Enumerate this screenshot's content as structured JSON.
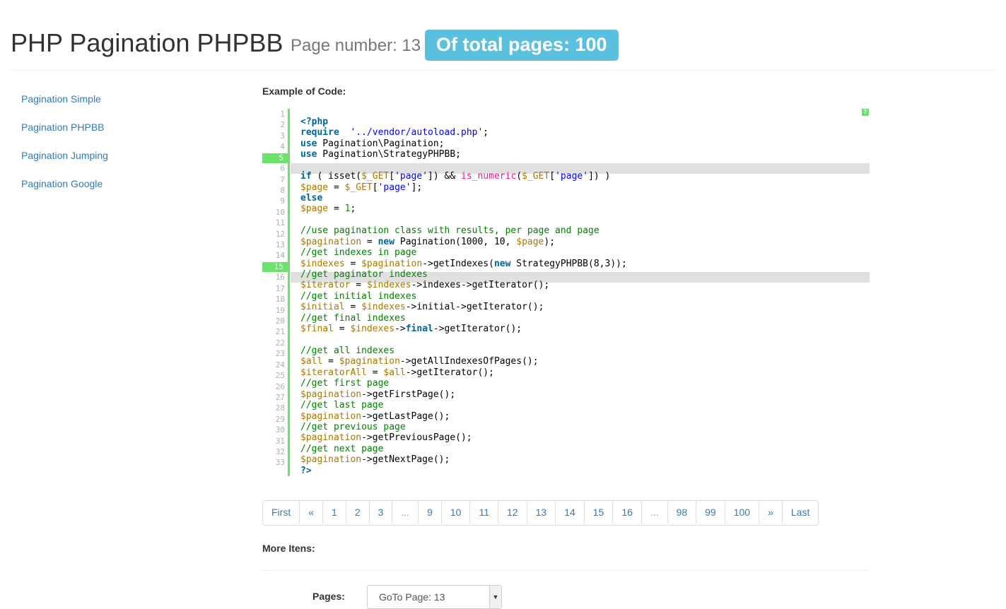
{
  "header": {
    "title": "PHP Pagination PHPBB",
    "page_number": "Page number: 13",
    "total_badge": "Of total pages: 100"
  },
  "sidebar": {
    "items": [
      {
        "label": "Pagination Simple"
      },
      {
        "label": "Pagination PHPBB"
      },
      {
        "label": "Pagination Jumping"
      },
      {
        "label": "Pagination Google"
      }
    ]
  },
  "code": {
    "heading": "Example of Code:",
    "help": "?",
    "line_numbers": [
      "1",
      "2",
      "3",
      "4",
      "5",
      "6",
      "7",
      "8",
      "9",
      "10",
      "11",
      "12",
      "13",
      "14",
      "15",
      "16",
      "17",
      "18",
      "19",
      "20",
      "21",
      "22",
      "23",
      "24",
      "25",
      "26",
      "27",
      "28",
      "29",
      "30",
      "31",
      "32",
      "33"
    ],
    "highlighted_numbers": [
      "5",
      "15"
    ],
    "lines": [
      [
        [
          "kw",
          "<?php"
        ]
      ],
      [
        [
          "kw",
          "require"
        ],
        [
          "",
          "  "
        ],
        [
          "str",
          "'../vendor/autoload.php'"
        ],
        [
          "",
          ";"
        ]
      ],
      [
        [
          "kw",
          "use"
        ],
        [
          "",
          " Pagination\\Pagination;"
        ]
      ],
      [
        [
          "kw",
          "use"
        ],
        [
          "",
          " Pagination\\StrategyPHPBB;"
        ]
      ],
      [],
      [
        [
          "kw",
          "if"
        ],
        [
          "",
          " ( isset("
        ],
        [
          "var",
          "$_GET"
        ],
        [
          "",
          "["
        ],
        [
          "str",
          "'page'"
        ],
        [
          "",
          "]) && "
        ],
        [
          "fn",
          "is_numeric"
        ],
        [
          "",
          "("
        ],
        [
          "var",
          "$_GET"
        ],
        [
          "",
          "["
        ],
        [
          "str",
          "'page'"
        ],
        [
          "",
          "]) )"
        ]
      ],
      [
        [
          "var",
          "$page"
        ],
        [
          "",
          " = "
        ],
        [
          "var",
          "$_GET"
        ],
        [
          "",
          "["
        ],
        [
          "str",
          "'page'"
        ],
        [
          "",
          "];"
        ]
      ],
      [
        [
          "kw",
          "else"
        ]
      ],
      [
        [
          "var",
          "$page"
        ],
        [
          "",
          " = "
        ],
        [
          "num",
          "1"
        ],
        [
          "",
          ";"
        ]
      ],
      [],
      [
        [
          "cm",
          "//use pagination class with results, per page and page"
        ]
      ],
      [
        [
          "var",
          "$pagination"
        ],
        [
          "",
          " = "
        ],
        [
          "kw",
          "new"
        ],
        [
          "",
          " Pagination(1000, 10, "
        ],
        [
          "var",
          "$page"
        ],
        [
          "",
          ");"
        ]
      ],
      [
        [
          "cm",
          "//get indexes in page"
        ]
      ],
      [
        [
          "var",
          "$indexes"
        ],
        [
          "",
          " = "
        ],
        [
          "var",
          "$pagination"
        ],
        [
          "",
          "->getIndexes("
        ],
        [
          "kw",
          "new"
        ],
        [
          "",
          " StrategyPHPBB(8,3));"
        ]
      ],
      [
        [
          "cm",
          "//get paginator indexes"
        ]
      ],
      [
        [
          "var",
          "$iterator"
        ],
        [
          "",
          " = "
        ],
        [
          "var",
          "$indexes"
        ],
        [
          "",
          "->indexes->getIterator();"
        ]
      ],
      [
        [
          "cm",
          "//get initial indexes"
        ]
      ],
      [
        [
          "var",
          "$initial"
        ],
        [
          "",
          " = "
        ],
        [
          "var",
          "$indexes"
        ],
        [
          "",
          "->initial->getIterator();"
        ]
      ],
      [
        [
          "cm",
          "//get final indexes"
        ]
      ],
      [
        [
          "var",
          "$final"
        ],
        [
          "",
          " = "
        ],
        [
          "var",
          "$indexes"
        ],
        [
          "",
          "->"
        ],
        [
          "kw",
          "final"
        ],
        [
          "",
          "->getIterator();"
        ]
      ],
      [],
      [
        [
          "cm",
          "//get all indexes"
        ]
      ],
      [
        [
          "var",
          "$all"
        ],
        [
          "",
          " = "
        ],
        [
          "var",
          "$pagination"
        ],
        [
          "",
          "->getAllIndexesOfPages();"
        ]
      ],
      [
        [
          "var",
          "$iteratorAll"
        ],
        [
          "",
          " = "
        ],
        [
          "var",
          "$all"
        ],
        [
          "",
          "->getIterator();"
        ]
      ],
      [
        [
          "cm",
          "//get first page"
        ]
      ],
      [
        [
          "var",
          "$pagination"
        ],
        [
          "",
          "->getFirstPage();"
        ]
      ],
      [
        [
          "cm",
          "//get last page"
        ]
      ],
      [
        [
          "var",
          "$pagination"
        ],
        [
          "",
          "->getLastPage();"
        ]
      ],
      [
        [
          "cm",
          "//get previous page"
        ]
      ],
      [
        [
          "var",
          "$pagination"
        ],
        [
          "",
          "->getPreviousPage();"
        ]
      ],
      [
        [
          "cm",
          "//get next page"
        ]
      ],
      [
        [
          "var",
          "$pagination"
        ],
        [
          "",
          "->getNextPage();"
        ]
      ],
      [
        [
          "kw",
          "?>"
        ]
      ]
    ]
  },
  "pagination": {
    "items": [
      "First",
      "«",
      "1",
      "2",
      "3",
      "...",
      "9",
      "10",
      "11",
      "12",
      "13",
      "14",
      "15",
      "16",
      "...",
      "98",
      "99",
      "100",
      "»",
      "Last"
    ]
  },
  "more": {
    "heading": "More Itens:"
  },
  "goto": {
    "label": "Pages:",
    "selected": "GoTo Page: 13"
  }
}
